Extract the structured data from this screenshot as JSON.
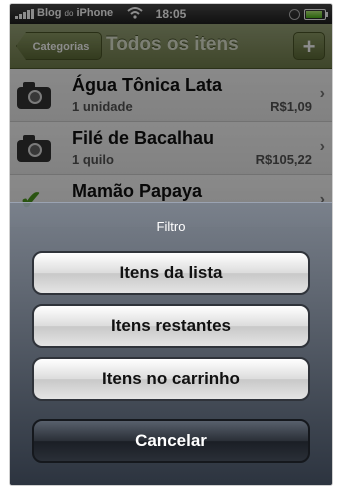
{
  "status_bar": {
    "carrier": "Blog",
    "carrier_small": "do",
    "carrier_end": "iPhone",
    "time": "18:05",
    "battery_level": 1.0
  },
  "nav": {
    "back_label": "Categorias",
    "title": "Todos os itens",
    "add_label": "+"
  },
  "items": [
    {
      "name": "Água Tônica Lata",
      "quantity": "1 unidade",
      "price": "R$1,09",
      "icon": "camera-icon"
    },
    {
      "name": "Filé de Bacalhau",
      "quantity": "1 quilo",
      "price": "R$105,22",
      "icon": "camera-icon"
    },
    {
      "name": "Mamão Papaya",
      "quantity": "",
      "price": "",
      "icon": "check-icon"
    }
  ],
  "action_sheet": {
    "title": "Filtro",
    "options": [
      "Itens da lista",
      "Itens restantes",
      "Itens no carrinho"
    ],
    "cancel": "Cancelar"
  }
}
